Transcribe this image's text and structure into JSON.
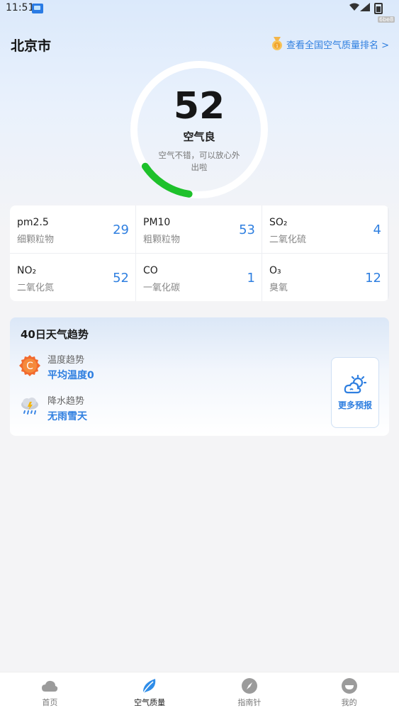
{
  "status_bar": {
    "time": "11:51",
    "tag": "6be8"
  },
  "header": {
    "city": "北京市",
    "rank_link": "查看全国空气质量排名 >"
  },
  "aqi": {
    "value": "52",
    "level": "空气良",
    "description": "空气不错，可以放心外出啦",
    "gauge_fill_fraction": 0.13,
    "gauge_color": "#1ec12b"
  },
  "pollutants": [
    {
      "name": "pm2.5",
      "sub": "细颗粒物",
      "value": "29"
    },
    {
      "name": "PM10",
      "sub": "粗颗粒物",
      "value": "53"
    },
    {
      "name": "SO₂",
      "sub": "二氧化硫",
      "value": "4"
    },
    {
      "name": "NO₂",
      "sub": "二氧化氮",
      "value": "52"
    },
    {
      "name": "CO",
      "sub": "一氧化碳",
      "value": "1"
    },
    {
      "name": "O₃",
      "sub": "臭氧",
      "value": "12"
    }
  ],
  "trend": {
    "title": "40日天气趋势",
    "temperature": {
      "label": "温度趋势",
      "value": "平均温度0",
      "icon": "thermometer-badge-icon"
    },
    "precipitation": {
      "label": "降水趋势",
      "value": "无雨雪天",
      "icon": "rain-cloud-icon"
    },
    "more_button": {
      "label": "更多预报",
      "icon": "sun-cloud-icon"
    }
  },
  "bottom_nav": [
    {
      "label": "首页",
      "icon": "cloud-icon",
      "active": false
    },
    {
      "label": "空气质量",
      "icon": "leaf-icon",
      "active": true
    },
    {
      "label": "指南针",
      "icon": "compass-icon",
      "active": false
    },
    {
      "label": "我的",
      "icon": "profile-icon",
      "active": false
    }
  ],
  "colors": {
    "accent": "#2f7fe0",
    "gauge_track": "#ffffff",
    "gauge_fill": "#1ec12b"
  }
}
